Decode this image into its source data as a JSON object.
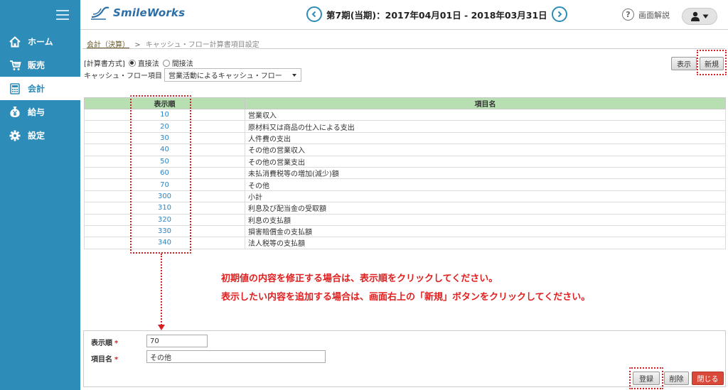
{
  "sidebar": {
    "items": [
      {
        "label": "ホーム",
        "icon": "home-icon"
      },
      {
        "label": "販売",
        "icon": "cart-icon"
      },
      {
        "label": "会計",
        "icon": "calculator-icon"
      },
      {
        "label": "給与",
        "icon": "yen-bag-icon"
      },
      {
        "label": "設定",
        "icon": "gear-icon"
      }
    ],
    "active_index": 2
  },
  "header": {
    "logo_text": "SmileWorks",
    "period": "第7期(当期)：2017年04月01日 - 2018年03月31日",
    "help_label": "画面解説"
  },
  "breadcrumb": {
    "parent": "会計（決算）",
    "separator": ">",
    "current": "キャッシュ・フロー計算書項目設定"
  },
  "filters": {
    "method_label": "[計算書方式]",
    "radio_direct": "直接法",
    "radio_indirect": "間接法",
    "item_label": "キャッシュ・フロー項目",
    "item_value": "営業活動によるキャッシュ・フロー"
  },
  "toolbar": {
    "show_label": "表示",
    "new_label": "新規"
  },
  "table": {
    "headers": [
      "表示順",
      "項目名"
    ],
    "rows": [
      {
        "order": "10",
        "name": "営業収入"
      },
      {
        "order": "20",
        "name": "原材料又は商品の仕入による支出"
      },
      {
        "order": "30",
        "name": "人件費の支出"
      },
      {
        "order": "40",
        "name": "その他の営業収入"
      },
      {
        "order": "50",
        "name": "その他の営業支出"
      },
      {
        "order": "60",
        "name": "未払消費税等の増加(減少)額"
      },
      {
        "order": "70",
        "name": "その他"
      },
      {
        "order": "300",
        "name": "小計"
      },
      {
        "order": "310",
        "name": "利息及び配当金の受取額"
      },
      {
        "order": "320",
        "name": "利息の支払額"
      },
      {
        "order": "330",
        "name": "損害賠償金の支払額"
      },
      {
        "order": "340",
        "name": "法人税等の支払額"
      }
    ]
  },
  "notes": {
    "line1": "初期値の内容を修正する場合は、表示順をクリックしてください。",
    "line2": "表示したい内容を追加する場合は、画面右上の「新規」ボタンをクリックしてください。"
  },
  "form": {
    "order_label": "表示順",
    "order_value": "70",
    "name_label": "項目名",
    "name_value": "その他",
    "required_mark": "*",
    "register_label": "登録",
    "delete_label": "削除",
    "close_label": "閉じる"
  },
  "colors": {
    "sidebar": "#2e8cb8",
    "table_header": "#b7dfb2",
    "link": "#2e84c0",
    "annotation": "#d42020",
    "close_button": "#d9493a"
  }
}
